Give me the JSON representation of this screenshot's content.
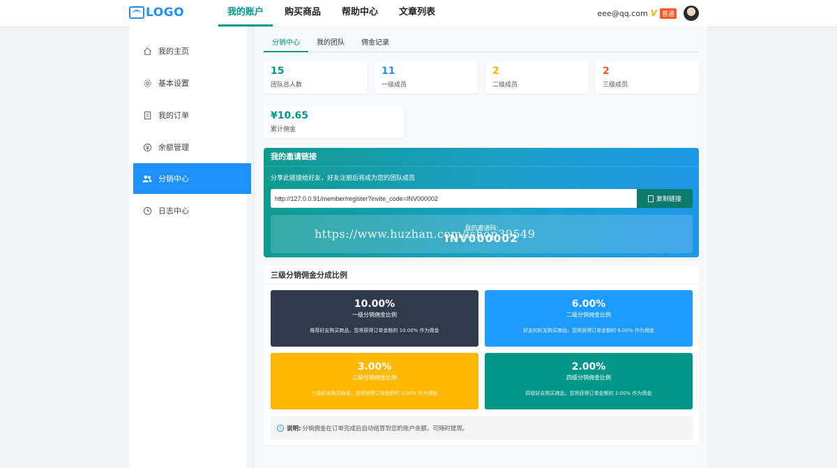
{
  "header": {
    "logo_text": "LOGO",
    "nav": [
      "我的账户",
      "购买商品",
      "帮助中心",
      "文章列表"
    ],
    "user_email": "eee@qq.com",
    "vip_mark": "V",
    "badge": "普通",
    "accent": "#009688"
  },
  "sidebar": {
    "items": [
      {
        "label": "我的主页",
        "icon": "home-icon"
      },
      {
        "label": "基本设置",
        "icon": "gear-icon"
      },
      {
        "label": "我的订单",
        "icon": "order-icon"
      },
      {
        "label": "余额管理",
        "icon": "yen-icon"
      },
      {
        "label": "分销中心",
        "icon": "users-icon"
      },
      {
        "label": "日志中心",
        "icon": "clock-icon"
      }
    ],
    "active_color": "#1e90ff"
  },
  "tabs": [
    "分销中心",
    "我的团队",
    "佣金记录"
  ],
  "stats": [
    {
      "value": "15",
      "label": "团队总人数",
      "color": "#009688"
    },
    {
      "value": "11",
      "label": "一级成员",
      "color": "#1e90ff"
    },
    {
      "value": "2",
      "label": "二级成员",
      "color": "#f5b400"
    },
    {
      "value": "2",
      "label": "三级成员",
      "color": "#ff5722"
    },
    {
      "value": "¥10.65",
      "label": "累计佣金",
      "color": "#009688"
    }
  ],
  "invite": {
    "title": "我的邀请链接",
    "desc": "分享此链接给好友，好友注册后将成为您的团队成员",
    "link": "http://127.0.0.91/member/register?invite_code=INV000002",
    "copy_label": "复制链接",
    "code_label": "我的邀请码:",
    "code": "INV000002"
  },
  "watermark": "https://www.huzhan.com/ishop39549",
  "ratios": {
    "title": "三级分销佣金分成比例",
    "items": [
      {
        "pct": "10.00%",
        "name": "一级分销佣金比例",
        "desc": "推荐好友购买商品，您将获得订单金额的 10.00% 作为佣金",
        "color": "#2f3a4f"
      },
      {
        "pct": "6.00%",
        "name": "二级分销佣金比例",
        "desc": "好友的好友购买商品，您将获得订单金额的 6.00% 作为佣金",
        "color": "#1e9bff"
      },
      {
        "pct": "3.00%",
        "name": "三级分销佣金比例",
        "desc": "三级好友购买商品，您将获得订单金额的 3.00% 作为佣金",
        "color": "#ffb800"
      },
      {
        "pct": "2.00%",
        "name": "四级分销佣金比例",
        "desc": "四级好友购买商品，您将获得订单金额的 2.00% 作为佣金",
        "color": "#009688"
      }
    ],
    "note_label": "说明:",
    "note_text": "分销佣金在订单完成后自动结算到您的账户余额，可随时提现。"
  }
}
